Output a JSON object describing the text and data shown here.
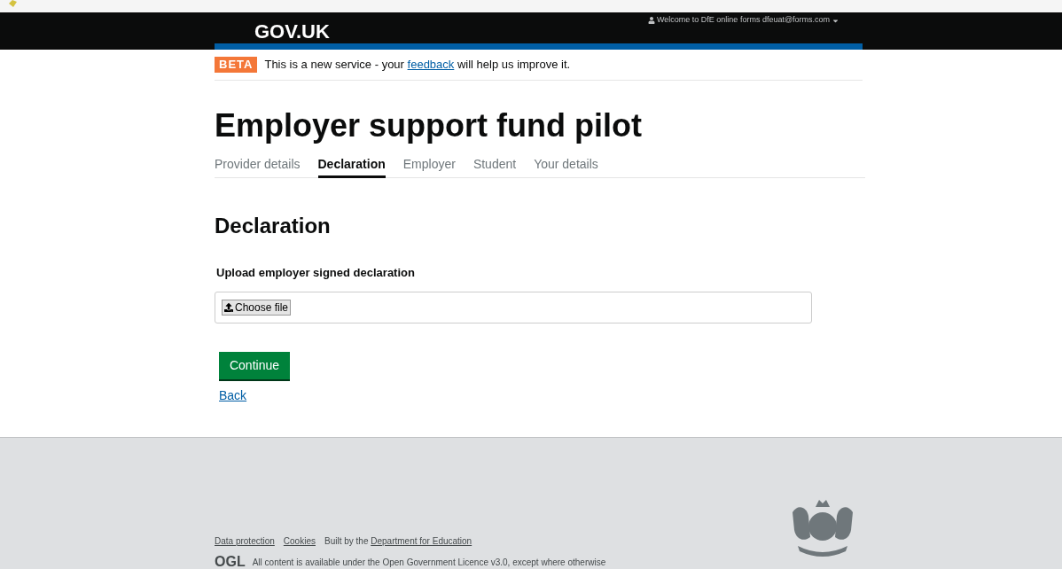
{
  "header": {
    "logo": "GOV.UK",
    "account": "Welcome to DfE online forms dfeuat@forms.com"
  },
  "phase_banner": {
    "tag": "BETA",
    "before": "This is a new service - your",
    "link": "feedback",
    "after": "will help us improve it."
  },
  "title": "Employer support fund pilot",
  "tabs": [
    {
      "label": "Provider details",
      "selected": false
    },
    {
      "label": "Declaration",
      "selected": true
    },
    {
      "label": "Employer",
      "selected": false
    },
    {
      "label": "Student",
      "selected": false
    },
    {
      "label": "Your details",
      "selected": false
    }
  ],
  "section_heading": "Declaration",
  "upload": {
    "label": "Upload employer signed declaration",
    "button": "Choose file"
  },
  "continue_button": "Continue",
  "back_link": "Back",
  "footer": {
    "links": [
      "Data protection",
      "Cookies"
    ],
    "built_by": "Built by the",
    "built_by_link": "Department for Education",
    "licence_logo": "OGL",
    "licence": "All content is available under the Open Government Licence v3.0, except where otherwise"
  }
}
